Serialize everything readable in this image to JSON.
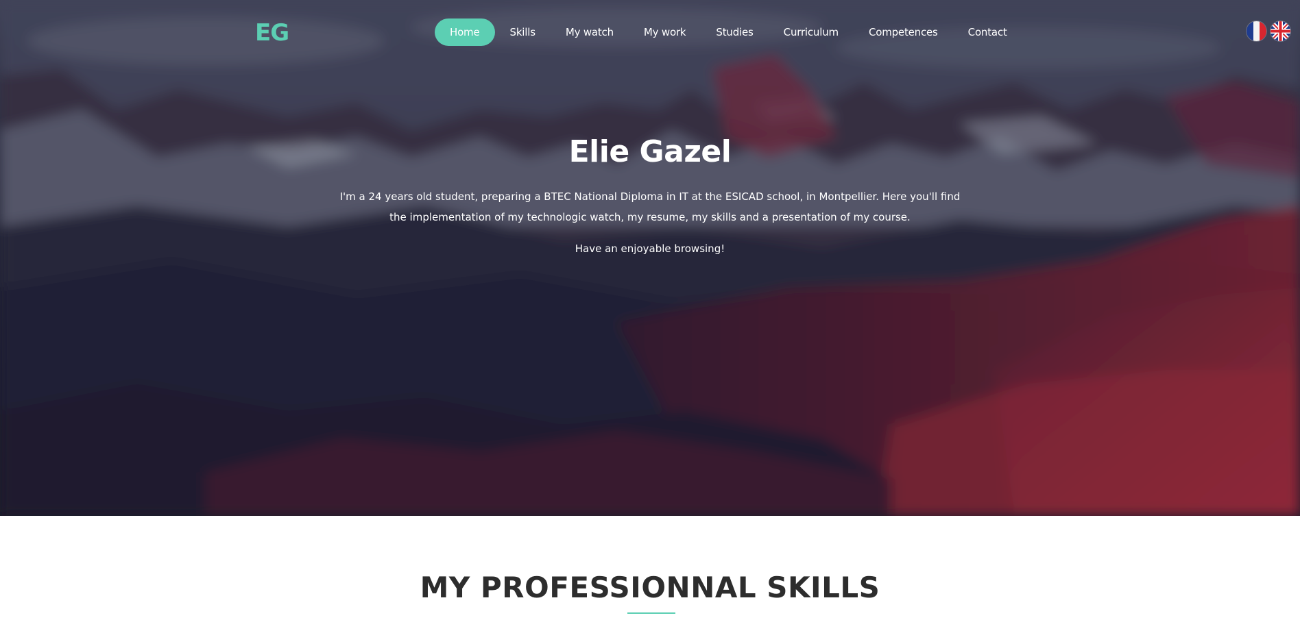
{
  "header": {
    "logo": "EG",
    "nav": [
      {
        "label": "Home",
        "active": true
      },
      {
        "label": "Skills",
        "active": false
      },
      {
        "label": "My watch",
        "active": false
      },
      {
        "label": "My work",
        "active": false
      },
      {
        "label": "Studies",
        "active": false
      },
      {
        "label": "Curriculum",
        "active": false
      },
      {
        "label": "Competences",
        "active": false
      },
      {
        "label": "Contact",
        "active": false
      }
    ],
    "languages": [
      {
        "icon": "france-flag-icon"
      },
      {
        "icon": "uk-flag-icon"
      }
    ]
  },
  "hero": {
    "title": "Elie Gazel",
    "intro": "I'm a 24 years old student, preparing a BTEC National Diploma in IT at the ESICAD school, in Montpellier. Here you'll find the implementation of my technologic watch, my resume, my skills and a presentation of my course.",
    "greeting": "Have an enjoyable browsing!"
  },
  "skills": {
    "heading": "MY PROFESSIONNAL SKILLS"
  },
  "colors": {
    "accent": "#5ccfb3",
    "heading": "#2d2d2d"
  }
}
